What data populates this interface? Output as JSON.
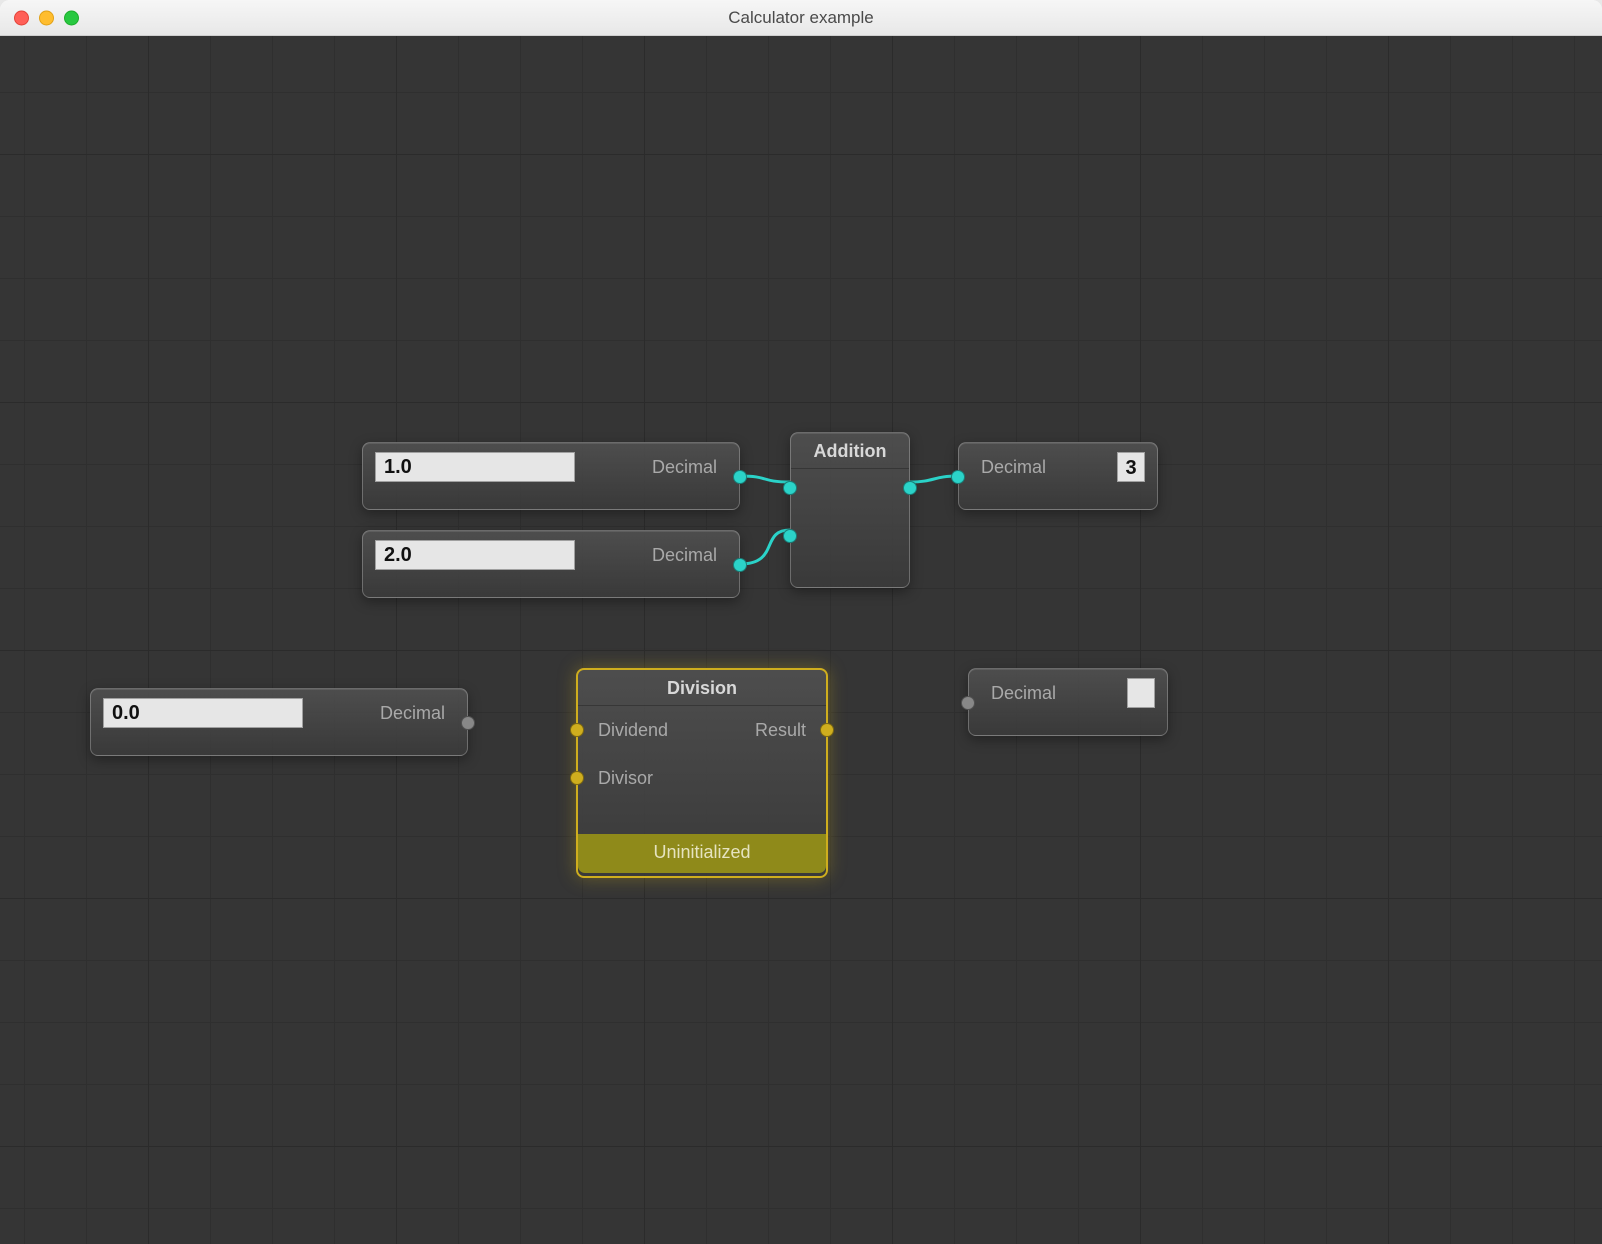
{
  "window": {
    "title": "Calculator example"
  },
  "nodes": {
    "in1": {
      "value": "1.0",
      "out_label": "Decimal"
    },
    "in2": {
      "value": "2.0",
      "out_label": "Decimal"
    },
    "in3": {
      "value": "0.0",
      "out_label": "Decimal"
    },
    "add": {
      "title": "Addition"
    },
    "div": {
      "title": "Division",
      "in1_label": "Dividend",
      "in2_label": "Divisor",
      "out_label": "Result",
      "status": "Uninitialized"
    },
    "out1": {
      "in_label": "Decimal",
      "value": "3"
    },
    "out2": {
      "in_label": "Decimal",
      "value": ""
    }
  },
  "colors": {
    "connected_port": "#2bd3c9",
    "selected_port": "#cfae1e",
    "idle_port": "#888888",
    "selection_border": "#cfae1e",
    "status_bg": "#8f8a1a"
  }
}
